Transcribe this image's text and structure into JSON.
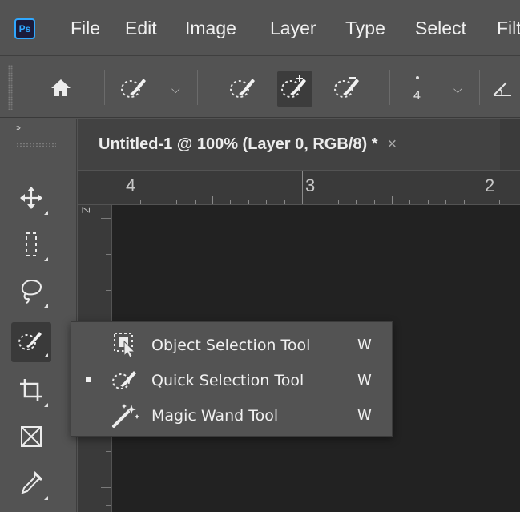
{
  "app": {
    "logo": "Ps",
    "accent_color": "#30a8ff"
  },
  "menu": {
    "items": [
      "File",
      "Edit",
      "Image",
      "Layer",
      "Type",
      "Select",
      "Filt"
    ]
  },
  "options_bar": {
    "home_icon": "home-icon",
    "tool_preset_icon": "quick-selection-icon",
    "mode_icons": [
      "new-selection-brush-icon",
      "add-to-selection-brush-icon",
      "subtract-from-selection-brush-icon"
    ],
    "brush_size": "4",
    "angle_icon": "angle-icon"
  },
  "document": {
    "tab_title": "Untitled-1 @ 100% (Layer 0, RGB/8) *",
    "close_glyph": "×"
  },
  "ruler": {
    "top_labels": [
      "4",
      "3",
      "2"
    ],
    "left_label": "Z"
  },
  "toolbar": {
    "collapse_glyph": "››",
    "tools": [
      "move-tool-icon",
      "marquee-tool-icon",
      "lasso-tool-icon",
      "quick-selection-tool-icon",
      "crop-tool-icon",
      "frame-tool-icon",
      "eyedropper-tool-icon"
    ],
    "active_tool": "quick-selection-tool-icon"
  },
  "flyout": {
    "items": [
      {
        "label": "Object Selection Tool",
        "shortcut": "W",
        "icon": "object-selection-icon",
        "selected": false
      },
      {
        "label": "Quick Selection Tool",
        "shortcut": "W",
        "icon": "quick-selection-icon",
        "selected": true
      },
      {
        "label": "Magic Wand Tool",
        "shortcut": "W",
        "icon": "magic-wand-icon",
        "selected": false
      }
    ]
  }
}
